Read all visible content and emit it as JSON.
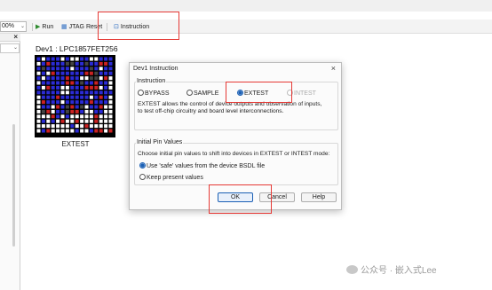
{
  "toolbar": {
    "zoom": "00%",
    "run_label": "Run",
    "jtag_reset_label": "JTAG Reset",
    "instruction_label": "Instruction"
  },
  "device": {
    "title": "Dev1 : LPC1857FET256",
    "instruction_caption": "EXTEST"
  },
  "dialog": {
    "title": "Dev1 Instruction",
    "instruction_group": "Instruction",
    "options": [
      "BYPASS",
      "SAMPLE",
      "EXTEST",
      "INTEST"
    ],
    "selected_option": "EXTEST",
    "description_lines": [
      "EXTEST allows the control of device outputs and observation of inputs,",
      "to test off-chip circuitry and board level interconnections."
    ],
    "initial_group": "Initial Pin Values",
    "initial_prompt": "Choose initial pin values to shift into devices in EXTEST or INTEST mode:",
    "use_safe_label": "Use 'safe' values from the device BSDL file",
    "keep_present_label": "Keep present values",
    "ok_label": "OK",
    "cancel_label": "Cancel",
    "help_label": "Help"
  },
  "watermark": "公众号 · 嵌入式Lee",
  "colors": {
    "highlight": "#e53935",
    "accent": "#1a5fb4"
  }
}
